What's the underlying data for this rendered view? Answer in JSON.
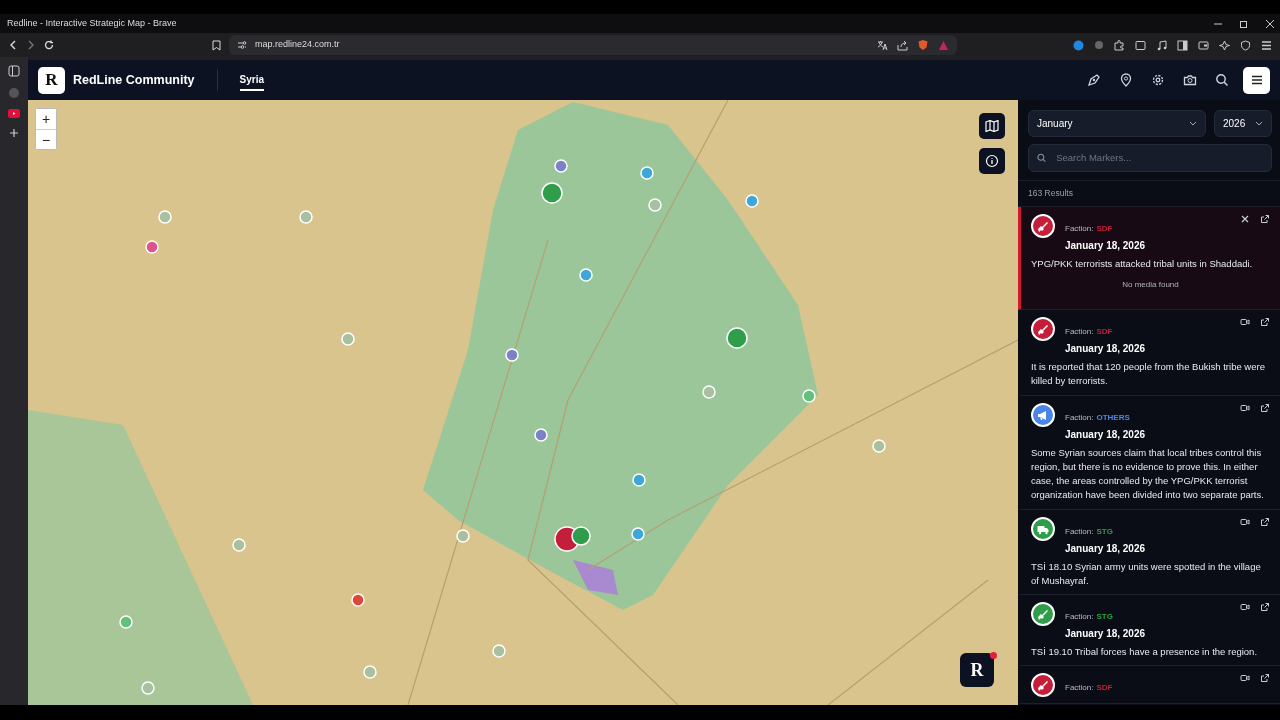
{
  "browser": {
    "title": "Redline - Interactive Strategic Map - Brave",
    "url": "map.redline24.com.tr"
  },
  "app": {
    "logo_letter": "R",
    "name": "RedLine Community",
    "tabs": [
      {
        "label": "Syria",
        "selected": true
      }
    ]
  },
  "map": {
    "zoom_in": "+",
    "zoom_out": "−",
    "badge_letter": "R"
  },
  "filters": {
    "month": "January",
    "year": "2026",
    "search_placeholder": "Search Markers...",
    "results": "163 Results"
  },
  "events": [
    {
      "faction_label": "Faction:",
      "faction": "SDF",
      "color": "#c41e3a",
      "kind": "rifle",
      "date": "January 18, 2026",
      "text": "YPG/PKK terrorists attacked tribal units in Shaddadi.",
      "media": "No media found",
      "dismissible": true,
      "selected": true
    },
    {
      "faction_label": "Faction:",
      "faction": "SDF",
      "color": "#c41e3a",
      "kind": "rifle",
      "date": "January 18, 2026",
      "text": "It is reported that 120 people from the Bukish tribe were killed by terrorists.",
      "dismissible": false,
      "selected": false
    },
    {
      "faction_label": "Faction:",
      "faction": "OTHERS",
      "color": "#4a86e8",
      "kind": "megaphone",
      "date": "January 18, 2026",
      "text": "Some Syrian sources claim that local tribes control this region, but there is no evidence to prove this. In either case, the areas controlled by the YPG/PKK terrorist organization have been divided into two separate parts.",
      "dismissible": false,
      "selected": false
    },
    {
      "faction_label": "Faction:",
      "faction": "STG",
      "color": "#2e9e4a",
      "kind": "truck",
      "date": "January 18, 2026",
      "text": "TSİ 18.10 Syrian army units were spotted in the village of Mushayraf.",
      "dismissible": false,
      "selected": false
    },
    {
      "faction_label": "Faction:",
      "faction": "STG",
      "color": "#2e9e4a",
      "kind": "rifle",
      "date": "January 18, 2026",
      "text": "TSİ 19.10 Tribal forces have a presence in the region.",
      "dismissible": false,
      "selected": false
    },
    {
      "faction_label": "Faction:",
      "faction": "SDF",
      "color": "#c41e3a",
      "kind": "rifle",
      "dismissible": false,
      "selected": false
    }
  ]
}
